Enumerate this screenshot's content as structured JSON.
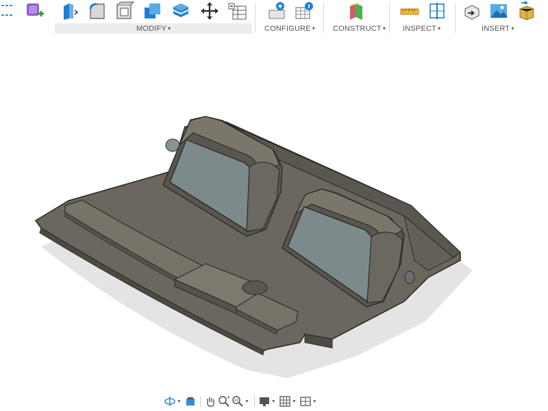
{
  "toolbar": {
    "groups": {
      "modify": "MODIFY",
      "configure": "CONFIGURE",
      "construct": "CONSTRUCT",
      "inspect": "INSPECT",
      "insert": "INSERT"
    },
    "caret": "▾",
    "icons": [
      "sketch-dimension-icon",
      "create-form-icon",
      "press-pull-icon",
      "fillet-icon",
      "shell-icon",
      "combine-icon",
      "stack-icon",
      "move-icon",
      "parameters-table-icon",
      "configure-add-icon",
      "configure-table-icon",
      "offset-plane-icon",
      "measure-icon",
      "section-analysis-icon",
      "insert-derive-icon",
      "insert-canvas-icon",
      "insert-mcmaster-icon"
    ]
  },
  "navbar": {
    "icons": [
      "orbit-icon",
      "look-at-icon",
      "pan-hand-icon",
      "zoom-icon",
      "zoom-window-icon",
      "display-settings-icon",
      "grid-icon",
      "viewports-icon"
    ]
  },
  "colors": {
    "model_face": "#5e5a52",
    "model_top": "#6d6960",
    "model_edge": "#2d2b27",
    "screen_face": "#7d8a8c",
    "shadow": "#e3e3e3",
    "accent_blue": "#2f8fd9"
  }
}
